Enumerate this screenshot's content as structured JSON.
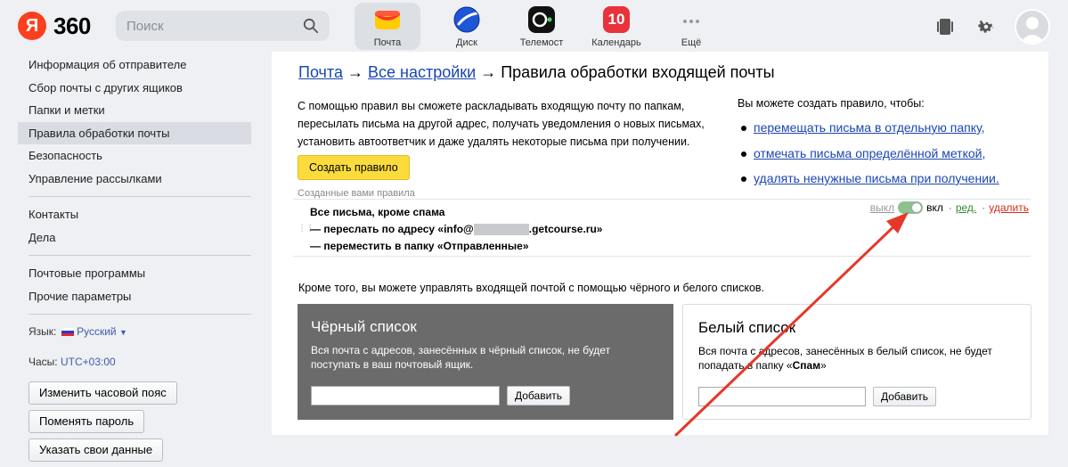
{
  "header": {
    "logo_letter": "Я",
    "logo_text": "360",
    "search_placeholder": "Поиск",
    "services": [
      {
        "label": "Почта",
        "icon": "mail-icon",
        "active": true
      },
      {
        "label": "Диск",
        "icon": "disk-icon"
      },
      {
        "label": "Телемост",
        "icon": "telemost-icon"
      },
      {
        "label": "Календарь",
        "icon": "calendar-icon",
        "badge": "10"
      },
      {
        "label": "Ещё",
        "icon": "more-icon"
      }
    ]
  },
  "sidebar": {
    "group1": [
      "Информация об отправителе",
      "Сбор почты с других ящиков",
      "Папки и метки",
      "Правила обработки почты",
      "Безопасность",
      "Управление рассылками"
    ],
    "active_item": "Правила обработки почты",
    "group2": [
      "Контакты",
      "Дела"
    ],
    "group3": [
      "Почтовые программы",
      "Прочие параметры"
    ],
    "language_label": "Язык:",
    "language_value": "Русский",
    "tz_label": "Часы:",
    "tz_value": "UTC+03:00",
    "buttons": [
      "Изменить часовой пояс",
      "Поменять пароль",
      "Указать свои данные"
    ]
  },
  "main": {
    "crumb_mail": "Почта",
    "crumb_sep1": " → ",
    "crumb_settings": "Все настройки",
    "crumb_sep2": " → ",
    "crumb_current": "Правила обработки входящей почты",
    "intro": "С помощью правил вы сможете раскладывать входящую почту по папкам, пересылать письма на другой адрес, получать уведомления о новых письмах, установить автоответчик и даже удалять некоторые письма при получении.",
    "create_button": "Создать правило",
    "right_title": "Вы можете создать правило, чтобы:",
    "right_items": [
      "перемещать письма в отдельную папку,",
      "отмечать письма определённой меткой,",
      "удалять ненужные письма при получении."
    ],
    "rules_caption": "Созданные вами правила",
    "rule": {
      "line1": "Все письма, кроме спама",
      "line2_prefix": "— переслать по адресу «info@",
      "line2_suffix": ".getcourse.ru»",
      "line3": "— переместить в папку «Отправленные»",
      "off": "выкл",
      "on": "вкл",
      "edit": "ред.",
      "delete": "удалить",
      "enabled": true
    },
    "also_text": "Кроме того, вы можете управлять входящей почтой с помощью чёрного и белого списков.",
    "blacklist": {
      "title": "Чёрный список",
      "desc": "Вся почта с адресов, занесённых в чёрный список, не будет поступать в ваш почтовый ящик.",
      "add": "Добавить"
    },
    "whitelist": {
      "title": "Белый список",
      "desc_prefix": "Вся почта с адресов, занесённых в белый список, не будет попадать в папку «",
      "desc_bold": "Спам",
      "desc_suffix": "»",
      "add": "Добавить"
    }
  },
  "colors": {
    "accent_yellow": "#fcdb3c",
    "link_blue": "#1a46b4",
    "delete_red": "#d62c1a",
    "edit_green": "#2f8e2f",
    "annotation_arrow": "#e5382a"
  }
}
